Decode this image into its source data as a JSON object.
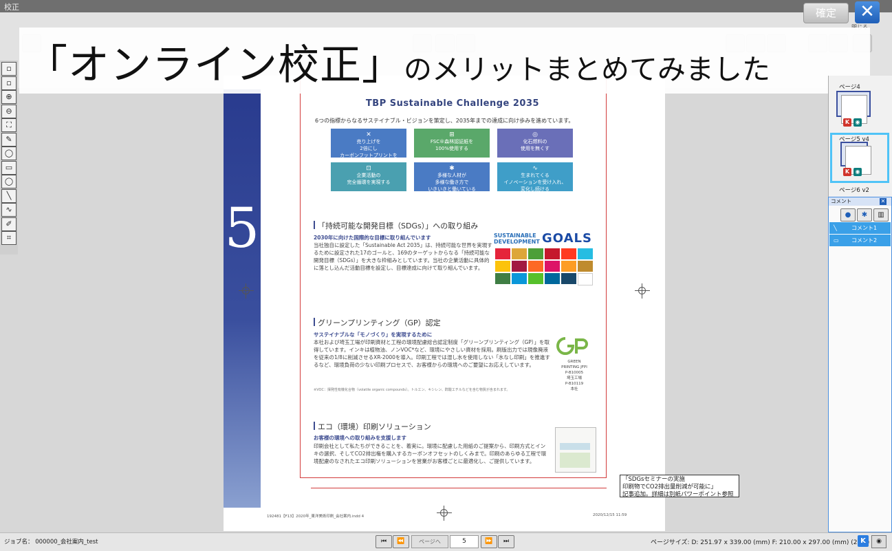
{
  "app": {
    "title": "校正"
  },
  "toolbar": {
    "confirm_label": "確定",
    "close_label": "✕",
    "close_sub": "閉じる"
  },
  "banner": {
    "big": "「オンライン校正」",
    "small": "のメリットまとめてみました"
  },
  "left_tools": [
    "▫",
    "▫",
    "⊕",
    "⊖",
    "⛶",
    "✎",
    "◯",
    "▭",
    "◯",
    "╲",
    "∿",
    "✐",
    "⌗"
  ],
  "document": {
    "big_number": "5",
    "title": "TBP Sustainable Challenge 2035",
    "intro": "6つの指標からなるサステイナブル・ビジョンを策定し、2035年までの達成に向け歩みを進めています。",
    "tiles": [
      {
        "icon": "✕",
        "text": "売り上げを\n2倍にし\nカーボンフットプリントを\n50%減らす",
        "color": "#4a7bc4"
      },
      {
        "icon": "⊞",
        "text": "FSC®森林認証紙を\n100%使用する",
        "color": "#5aa86a"
      },
      {
        "icon": "◎",
        "text": "化石燃料の\n使用を無くす",
        "color": "#6a6fb8"
      },
      {
        "icon": "⊡",
        "text": "企業活動の\n完全循環を実現する",
        "color": "#4aa0b0"
      },
      {
        "icon": "✱",
        "text": "多様な人材が\n多様な働き方で\nいきいきと働いている",
        "color": "#4a7bc4"
      },
      {
        "icon": "∿",
        "text": "生まれてくる\nイノベーションを受け入れ、\n変化し続ける",
        "color": "#3f9ec8"
      }
    ],
    "sec1": {
      "title": "「持続可能な開発目標（SDGs）」への取り組み",
      "sub": "2030年に向けた国際的な目標に取り組んでいます",
      "body": "当社独自に設定した「Sustainable Act 2035」は、持続可能な世界を実現するために設定された17のゴールと、169のターゲットからなる「持続可能な開発目標（SDGs）」を大きな枠組みとしています。当社の企業活動に具体的に落とし込んだ活動目標を設定し、目標達成に向けて取り組んでいます。",
      "logo_l1": "SUSTAINABLE",
      "logo_l2": "DEVELOPMENT",
      "logo_goals": "GOALS"
    },
    "sdg_colors": [
      "#e5243b",
      "#dda63a",
      "#4c9f38",
      "#c5192d",
      "#ff3a21",
      "#26bde2",
      "#fcc30b",
      "#a21942",
      "#fd6925",
      "#dd1367",
      "#fd9d24",
      "#bf8b2e",
      "#3f7e44",
      "#0a97d9",
      "#56c02b",
      "#00689d",
      "#19486a",
      "#ffffff"
    ],
    "sec2": {
      "title": "グリーンプリンティング（GP）認定",
      "sub": "サステイナブルな「モノづくり」を実現するために",
      "body": "本社および埼玉工場が印刷資材と工程の環境配慮総合認定制度「グリーンプリンティング（GP）」を取得しています。インキは植物油、ノンVOC*など、環境にやさしい資材を採用。刷版出力では現像廃液を従来の1/8に削減させるXR-2000を導入。印刷工程では湿し水を使用しない「水なし印刷」を推進するなど、環境負荷の少ない印刷プロセスで、お客様からの環境へのご要望にお応えしています。",
      "note": "※VOC：揮発性有機化合物（volatile organic compounds）。トルエン、キシレン、酢酸エチルなどを含む物質が含まれます。",
      "gp_text": "GREEN PRINTING JFPI\nP-B10005\n埼玉工場\nP-B10119\n本社"
    },
    "sec3": {
      "title": "エコ（環境）印刷ソリューション",
      "sub": "お客様の環境への取り組みを支援します",
      "body": "印刷会社として私たちができることを、着実に。環境に配慮した用紙のご提案から、印刷方式とインキの選択、そしてCO2排出権を購入するカーボンオフセットのしくみまで。印刷のあらゆる工程で環境配慮のなされたエコ印刷ソリューションを営業がお客様ごとに最適化し、ご提供しています。"
    },
    "footer_left": "192481【F13】2020年_東洋美術印刷_会社案内.indd  4",
    "footer_right": "2020/12/15  11:59"
  },
  "comment_box": {
    "l1": "「SDGsセミナーの実施",
    "l2": "印刷物でCO2排出量削減が可能に」",
    "l3": "記事追加。詳細は別紙パワーポイント参照"
  },
  "pages_panel": {
    "title": "ページ4",
    "items": [
      {
        "label": "ページ5 v4"
      },
      {
        "label": "ページ6 v2"
      }
    ],
    "k_badge": "K",
    "eye_badge": "◉"
  },
  "comments_panel": {
    "title": "コメント",
    "close": "✕",
    "buttons": [
      "●",
      "✱",
      "▥"
    ],
    "items": [
      {
        "icon": "╲",
        "label": "コメント1"
      },
      {
        "icon": "▭",
        "label": "コメント2"
      }
    ]
  },
  "statusbar": {
    "job": "ジョブ名：  000000_会社案内_test",
    "nav_first": "⏮",
    "nav_prev": "⏪",
    "page_button": "ページへ",
    "page_value": "5",
    "nav_next": "⏩",
    "nav_last": "⏭",
    "page_size": "ページサイズ:  D: 251.97 x 339.00 (mm)  F: 210.00 x 297.00 (mm) (29%)",
    "k": "K",
    "eye": "◉"
  }
}
